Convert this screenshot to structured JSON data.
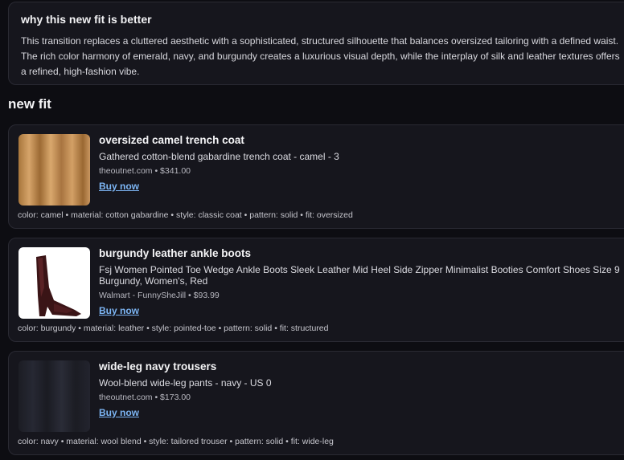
{
  "why": {
    "title": "why this new fit is better",
    "body": "This transition replaces a cluttered aesthetic with a sophisticated, structured silhouette that balances oversized tailoring with a defined waist. The rich color harmony of emerald, navy, and burgundy creates a luxurious visual depth, while the interplay of silk and leather textures offers a refined, high-fashion vibe."
  },
  "section_title": "new fit",
  "items": [
    {
      "name": "oversized camel trench coat",
      "description": "Gathered cotton-blend gabardine trench coat - camel - 3",
      "meta": "theoutnet.com • $341.00",
      "buy_label": "Buy now",
      "attributes": "color: camel • material: cotton gabardine • style: classic coat • pattern: solid • fit: oversized"
    },
    {
      "name": "burgundy leather ankle boots",
      "description": "Fsj Women Pointed Toe Wedge Ankle Boots Sleek Leather Mid Heel Side Zipper Minimalist Booties Comfort Shoes Size 9 Burgundy, Women's, Red",
      "meta": "Walmart - FunnySheJill • $93.99",
      "buy_label": "Buy now",
      "attributes": "color: burgundy • material: leather • style: pointed-toe • pattern: solid • fit: structured"
    },
    {
      "name": "wide-leg navy trousers",
      "description": "Wool-blend wide-leg pants - navy - US 0",
      "meta": "theoutnet.com • $173.00",
      "buy_label": "Buy now",
      "attributes": "color: navy • material: wool blend • style: tailored trouser • pattern: solid • fit: wide-leg"
    }
  ]
}
